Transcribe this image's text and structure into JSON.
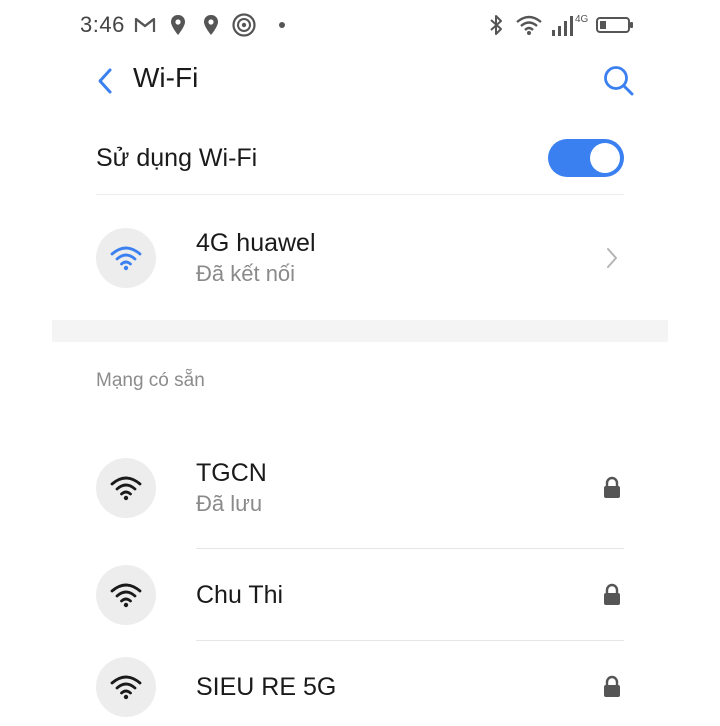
{
  "status_bar": {
    "time": "3:46",
    "left_icons": [
      "gmail-icon",
      "location-icon",
      "location-icon",
      "app-icon"
    ],
    "right_icons": [
      "bluetooth-icon",
      "wifi-icon",
      "signal-4g-icon",
      "battery-icon"
    ],
    "network_type": "4G"
  },
  "header": {
    "title": "Wi-Fi",
    "back_icon": "chevron-left-icon",
    "search_icon": "search-icon"
  },
  "wifi_toggle": {
    "label": "Sử dụng Wi-Fi",
    "enabled": true
  },
  "connected_network": {
    "name": "4G huawel",
    "status": "Đã kết nối"
  },
  "available": {
    "section_title": "Mạng có sẵn",
    "networks": [
      {
        "name": "TGCN",
        "status": "Đã lưu",
        "secured": true
      },
      {
        "name": "Chu Thi",
        "status": "",
        "secured": true
      },
      {
        "name": "SIEU RE 5G",
        "status": "",
        "secured": true
      }
    ]
  },
  "colors": {
    "accent": "#3a80f0",
    "text_primary": "#1a1a1a",
    "text_secondary": "#8a8a8a",
    "icon_bg": "#ededed"
  }
}
